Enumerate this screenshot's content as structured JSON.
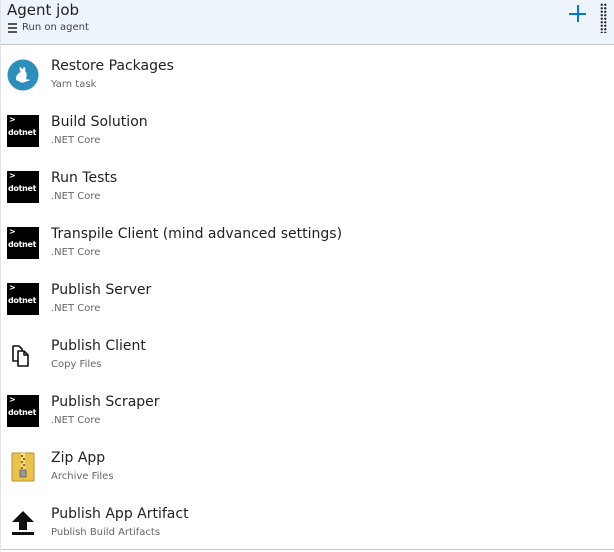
{
  "job": {
    "title": "Agent job",
    "subtitle": "Run on agent"
  },
  "colors": {
    "header_bg": "#eef4fc",
    "accent": "#0078d4",
    "yarn_blue": "#2c8ebb",
    "zip_yellow": "#e8c24a"
  },
  "tasks": [
    {
      "name": "Restore Packages",
      "type": "Yarn task",
      "icon": "yarn-icon"
    },
    {
      "name": "Build Solution",
      "type": ".NET Core",
      "icon": "dotnet-icon",
      "icon_text": "dotnet"
    },
    {
      "name": "Run Tests",
      "type": ".NET Core",
      "icon": "dotnet-icon",
      "icon_text": "dotnet"
    },
    {
      "name": "Transpile Client (mind advanced settings)",
      "type": ".NET Core",
      "icon": "dotnet-icon",
      "icon_text": "dotnet"
    },
    {
      "name": "Publish Server",
      "type": ".NET Core",
      "icon": "dotnet-icon",
      "icon_text": "dotnet"
    },
    {
      "name": "Publish Client",
      "type": "Copy Files",
      "icon": "copy-files-icon"
    },
    {
      "name": "Publish Scraper",
      "type": ".NET Core",
      "icon": "dotnet-icon",
      "icon_text": "dotnet"
    },
    {
      "name": "Zip App",
      "type": "Archive Files",
      "icon": "archive-zip-icon"
    },
    {
      "name": "Publish App Artifact",
      "type": "Publish Build Artifacts",
      "icon": "upload-arrow-icon"
    }
  ]
}
